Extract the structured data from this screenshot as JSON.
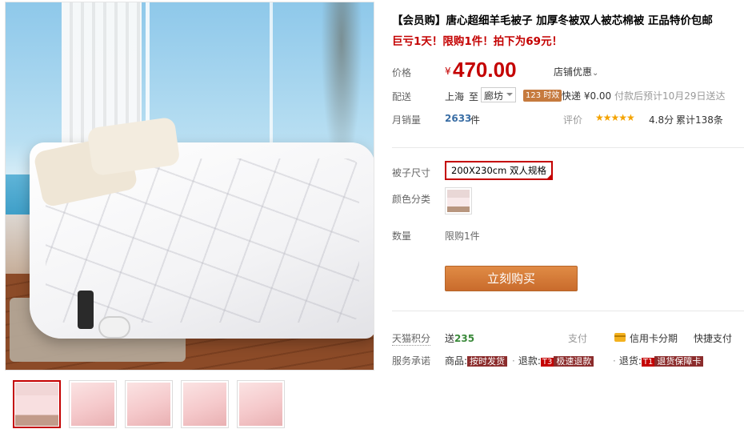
{
  "gallery": {
    "main_image": "white-quilt-bedroom-photo",
    "thumbnails": [
      "quilt-bed-thumb",
      "pink-quilt-thumb-1",
      "pink-quilt-thumb-2",
      "pink-quilt-thumb-3",
      "pink-quilt-thumb-4"
    ],
    "active_index": 0
  },
  "product": {
    "title": "【会员购】唐心超细羊毛被子 加厚冬被双人被芯棉被 正品特价包邮",
    "promo": "巨亏1天！限购1件！拍下为69元！"
  },
  "price": {
    "label": "价格",
    "currency": "¥",
    "value": "470.00",
    "shop_discount": "店铺优惠",
    "shop_discount_icon": "chevron-down-icon"
  },
  "shipping": {
    "label": "配送",
    "from": "上海",
    "to_word": "至",
    "destination": "廊坊",
    "time_badge": "123 时效",
    "method": "快递 ¥0.00",
    "estimate": "付款后预计10月29日送达"
  },
  "sales": {
    "label": "月销量",
    "count": "2633",
    "unit": "件",
    "rating_label": "评价",
    "stars": "★★★★★",
    "score": "4.8分",
    "total": "累计138条"
  },
  "options": {
    "size_label": "被子尺寸",
    "size_value": "200X230cm 双人规格",
    "color_label": "颜色分类",
    "quantity_label": "数量",
    "quantity_value": "限购1件"
  },
  "buy_button": "立刻购买",
  "bottom": {
    "points_label": "天猫积分",
    "points_prefix": "送",
    "points_value": "235",
    "pay_label": "支付",
    "pay_card": "信用卡分期",
    "pay_quick": "快捷支付",
    "service_label": "服务承诺",
    "svc1_prefix": "商品:",
    "svc1_tag": "按时发货",
    "svc2_prefix": "退款:",
    "svc2_code": "T3",
    "svc2_tag": "极速退款",
    "svc3_prefix": "退货:",
    "svc3_code": "T1",
    "svc3_tag": "退货保障卡"
  },
  "colors": {
    "accent_red": "#c40000",
    "buy_orange": "#d07a36",
    "link_blue": "#3a6ea5"
  }
}
